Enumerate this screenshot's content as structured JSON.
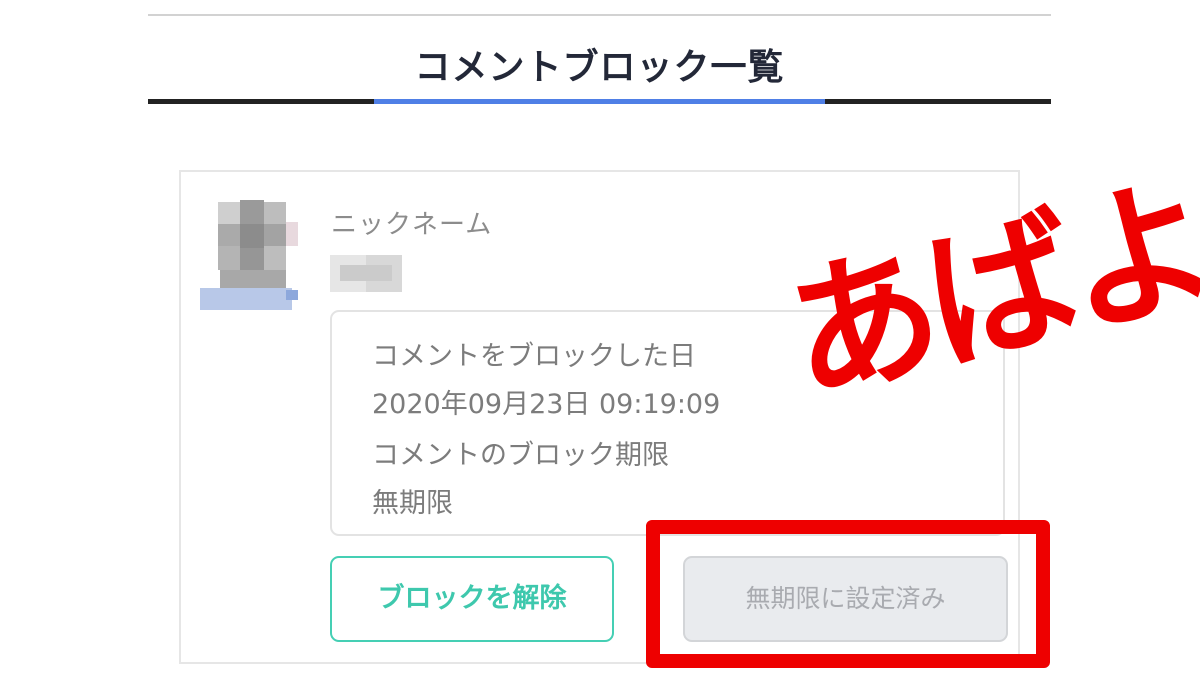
{
  "header": {
    "title": "コメントブロック一覧"
  },
  "entry": {
    "nickname_label": "ニックネーム",
    "blocked_date_label": "コメントをブロックした日",
    "blocked_date_value": "2020年09月23日 09:19:09",
    "block_period_label": "コメントのブロック期限",
    "block_period_value": "無期限",
    "unblock_button": "ブロックを解除",
    "indefinite_button": "無期限に設定済み"
  },
  "annotation": {
    "text": "あばよ!!"
  },
  "colors": {
    "tab_active": "#4f7fe6",
    "unblock_accent": "#45cfb4",
    "annotation_red": "#ee0000"
  }
}
